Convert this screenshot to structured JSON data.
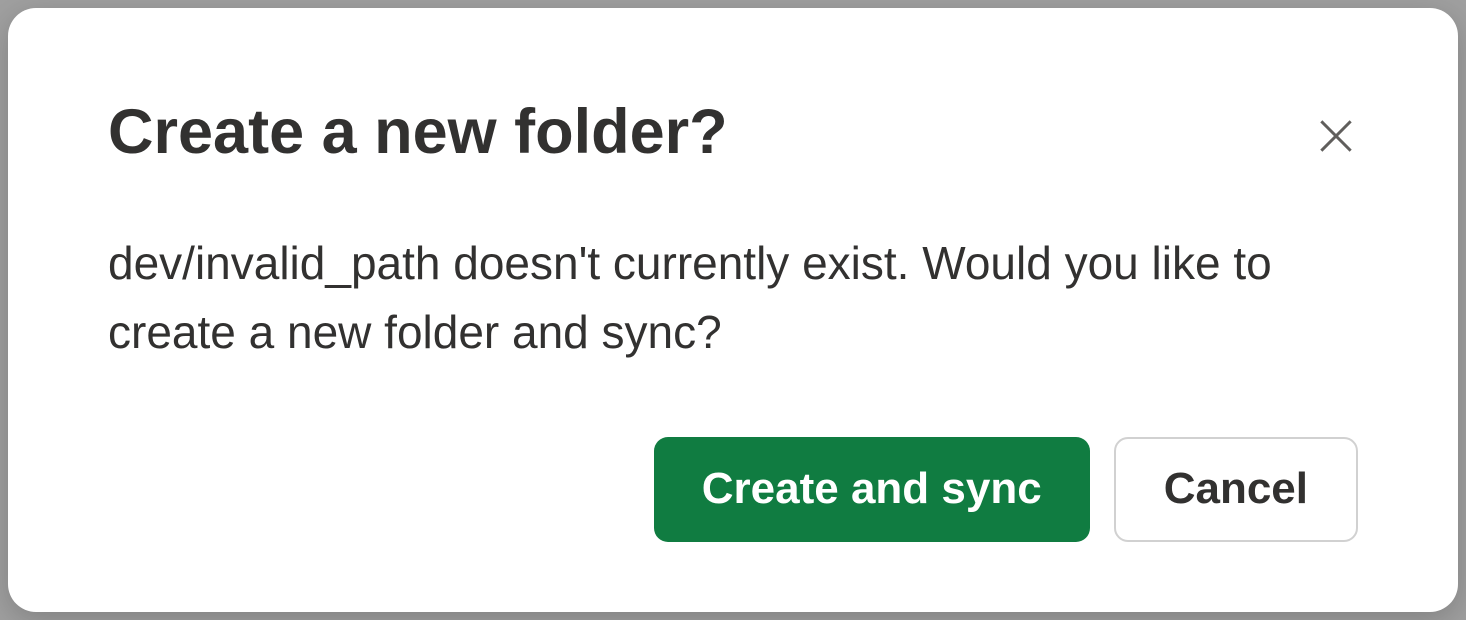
{
  "dialog": {
    "title": "Create a new folder?",
    "body": "dev/invalid_path doesn't currently exist. Would you like to create a new folder and sync?",
    "primary_button": "Create and sync",
    "secondary_button": "Cancel"
  }
}
